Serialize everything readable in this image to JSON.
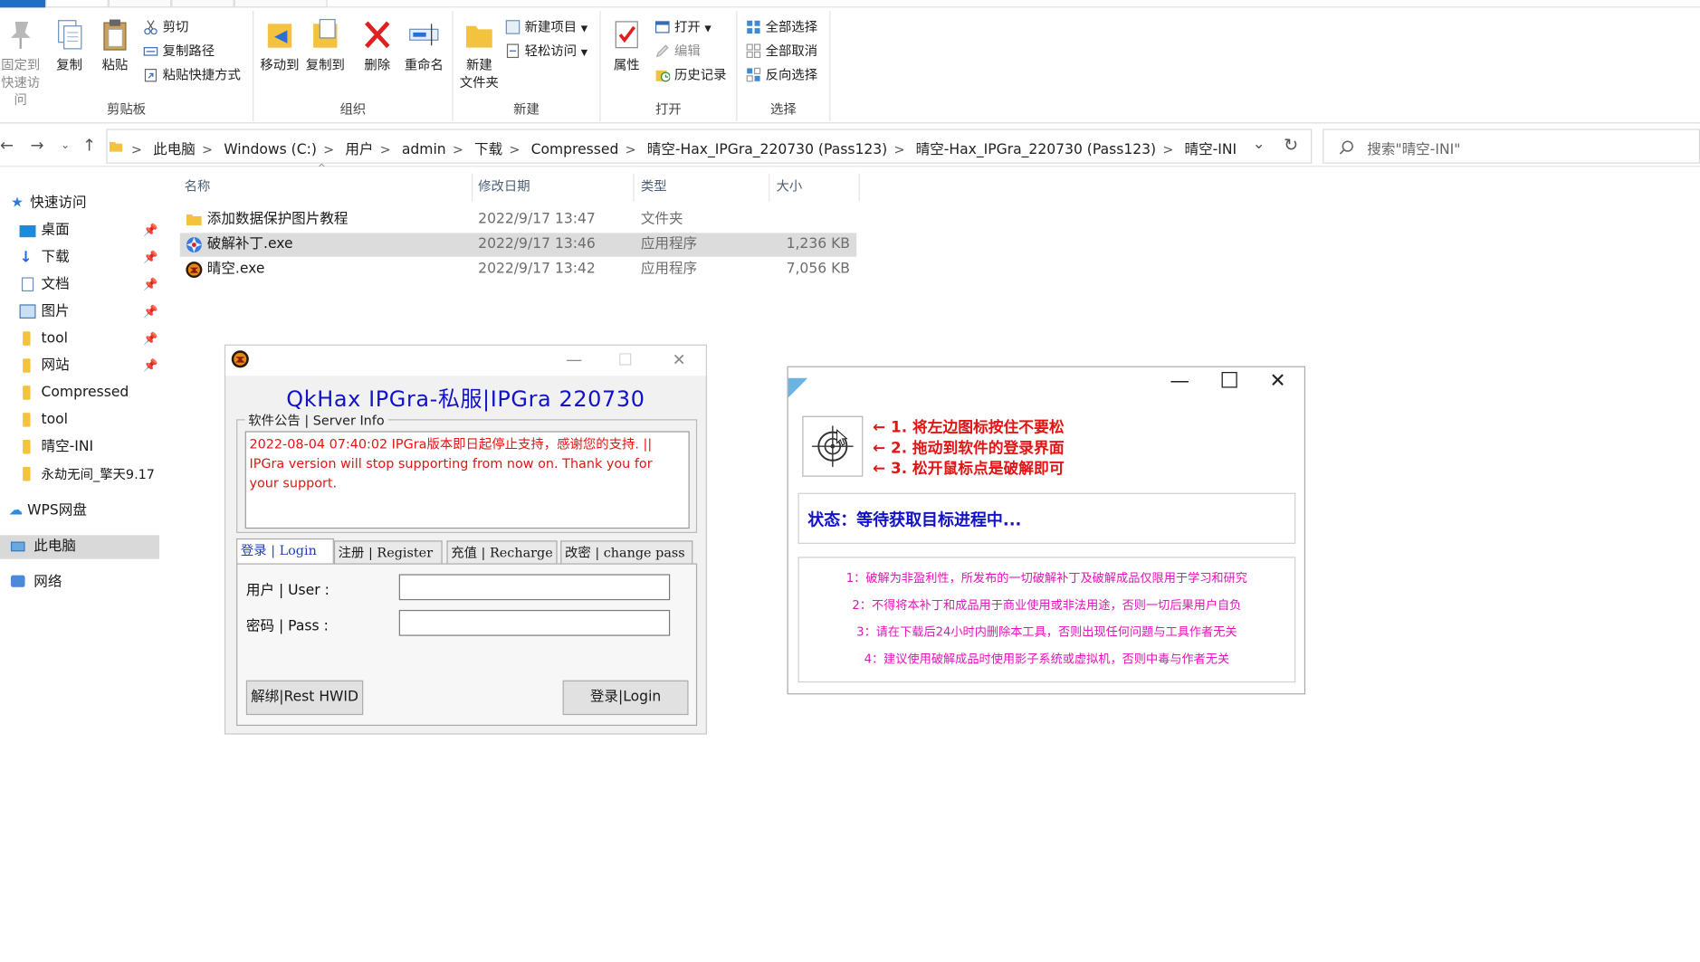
{
  "ribbon": {
    "groups": {
      "clipboard": "剪贴板",
      "organize": "组织",
      "new": "新建",
      "open": "打开",
      "select": "选择"
    },
    "buttons": {
      "pin_line1": "固定到",
      "pin_line2": "快速访问",
      "copy": "复制",
      "paste": "粘贴",
      "cut": "剪切",
      "copy_path": "复制路径",
      "paste_shortcut": "粘贴快捷方式",
      "move_to": "移动到",
      "copy_to": "复制到",
      "delete": "删除",
      "rename": "重命名",
      "new_folder_line1": "新建",
      "new_folder_line2": "文件夹",
      "new_item": "新建项目",
      "easy_access": "轻松访问",
      "properties": "属性",
      "open": "打开",
      "edit": "编辑",
      "history": "历史记录",
      "select_all": "全部选择",
      "select_none": "全部取消",
      "invert_selection": "反向选择"
    }
  },
  "address": {
    "crumbs": [
      "此电脑",
      "Windows (C:)",
      "用户",
      "admin",
      "下载",
      "Compressed",
      "晴空-Hax_IPGra_220730 (Pass123)",
      "晴空-Hax_IPGra_220730 (Pass123)",
      "晴空-INI"
    ],
    "search_placeholder": "搜索\"晴空-INI\""
  },
  "nav": {
    "quick_access": "快速访问",
    "items": [
      "桌面",
      "下载",
      "文档",
      "图片",
      "tool",
      "网站",
      "Compressed",
      "tool",
      "晴空-INI",
      "永劫无间_擎天9.17"
    ],
    "wps": "WPS网盘",
    "this_pc": "此电脑",
    "network": "网络"
  },
  "filelist": {
    "columns": [
      "名称",
      "修改日期",
      "类型",
      "大小"
    ],
    "rows": [
      {
        "name": "添加数据保护图片教程",
        "date": "2022/9/17 13:47",
        "type": "文件夹",
        "size": ""
      },
      {
        "name": "破解补丁.exe",
        "date": "2022/9/17 13:46",
        "type": "应用程序",
        "size": "1,236 KB"
      },
      {
        "name": "晴空.exe",
        "date": "2022/9/17 13:42",
        "type": "应用程序",
        "size": "7,056 KB"
      }
    ]
  },
  "login_window": {
    "title": "QkHax  IPGra-私服|IPGra 220730",
    "notice_label": "软件公告 | Server Info",
    "notice_text": "2022-08-04 07:40:02 IPGra版本即日起停止支持，感谢您的支持. || IPGra version will stop supporting from now on. Thank you for your support.",
    "tabs": [
      "登录 | Login",
      "注册 | Register",
      "充值 | Recharge",
      "改密 | change pass"
    ],
    "user_label": "用户 | User :",
    "pass_label": "密码 | Pass :",
    "user_value": "",
    "pass_value": "",
    "reset_button": "解绑|Rest HWID",
    "login_button": "登录|Login"
  },
  "drag_window": {
    "steps": [
      "← 1. 将左边图标按住不要松",
      "← 2. 拖动到软件的登录界面",
      "← 3. 松开鼠标点是破解即可"
    ],
    "status": "状态：等待获取目标进程中...",
    "disclaimer": [
      "1：破解为非盈利性，所发布的一切破解补丁及破解成品仅限用于学习和研究",
      "2：不得将本补丁和成品用于商业使用或非法用途，否则一切后果用户自负",
      "3：请在下载后24小时内删除本工具，否则出现任何问题与工具作者无关",
      "4：建议使用破解成品时使用影子系统或虚拟机，否则中毒与作者无关"
    ]
  },
  "colors": {
    "title_blue": "#1212c8",
    "notice_red": "#e51414",
    "disclaimer_magenta": "#e414b8",
    "selection_gray": "#dcdcdc",
    "folder_yellow": "#f3c23f"
  }
}
